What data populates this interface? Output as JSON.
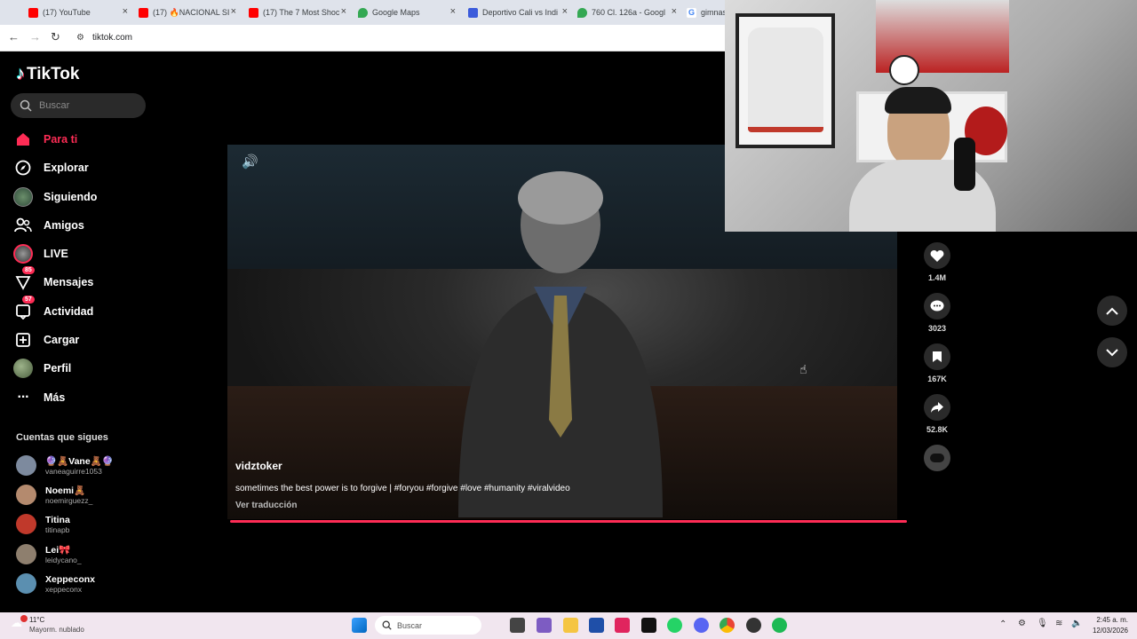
{
  "browser": {
    "tabs": [
      {
        "label": "(17) YouTube",
        "color": "#ff0000"
      },
      {
        "label": "(17) 🔥NACIONAL SI",
        "color": "#ff0000"
      },
      {
        "label": "(17) The 7 Most Shoc",
        "color": "#ff0000"
      },
      {
        "label": "Google Maps",
        "color": "#34a853"
      },
      {
        "label": "Deportivo Cali vs Indi",
        "color": "#3b5bdb"
      },
      {
        "label": "760 Cl. 126a - Googl",
        "color": "#34a853"
      },
      {
        "label": "gimnasi",
        "color": "#4285f4"
      }
    ],
    "url": "tiktok.com"
  },
  "tiktok": {
    "logo": "TikTok",
    "search_placeholder": "Buscar",
    "nav": [
      {
        "label": "Para ti",
        "icon": "home-icon",
        "active": true
      },
      {
        "label": "Explorar",
        "icon": "compass-icon"
      },
      {
        "label": "Siguiendo",
        "icon": "following-avatar-icon"
      },
      {
        "label": "Amigos",
        "icon": "friends-icon"
      },
      {
        "label": "LIVE",
        "icon": "live-icon"
      },
      {
        "label": "Mensajes",
        "icon": "paper-plane-icon",
        "badge": "85"
      },
      {
        "label": "Actividad",
        "icon": "activity-icon",
        "badge": "57"
      },
      {
        "label": "Cargar",
        "icon": "upload-icon"
      },
      {
        "label": "Perfil",
        "icon": "profile-avatar-icon"
      },
      {
        "label": "Más",
        "icon": "more-icon"
      }
    ],
    "following_heading": "Cuentas que sigues",
    "following": [
      {
        "name": "🔮🧸Vane🧸🔮",
        "handle": "vaneaguirre1053",
        "color": "#7d8a9e"
      },
      {
        "name": "Noemi🧸",
        "handle": "noemirguezz_",
        "color": "#b48a6e"
      },
      {
        "name": "Titina",
        "handle": "titinapb",
        "color": "#c0392b"
      },
      {
        "name": "Lei🎀",
        "handle": "leidycano_",
        "color": "#8e7f6e"
      },
      {
        "name": "Xeppeconx",
        "handle": "xeppeconx",
        "color": "#5b8fb0"
      }
    ],
    "video": {
      "username": "vidztoker",
      "caption": "sometimes the best power is to forgive | #foryou #forgive #love #humanity #viralvideo",
      "translate": "Ver traducción"
    },
    "actions": [
      {
        "icon": "heart-icon",
        "count": "1.4M"
      },
      {
        "icon": "comment-icon",
        "count": "3023"
      },
      {
        "icon": "bookmark-icon",
        "count": "167K"
      },
      {
        "icon": "share-icon",
        "count": "52.8K"
      },
      {
        "icon": "music-disc-icon",
        "count": ""
      }
    ]
  },
  "taskbar": {
    "weather_temp": "11°C",
    "weather_desc": "Mayorm. nublado",
    "search_label": "Buscar",
    "time": "2:45 a. m.",
    "date": "12/03/2026"
  }
}
